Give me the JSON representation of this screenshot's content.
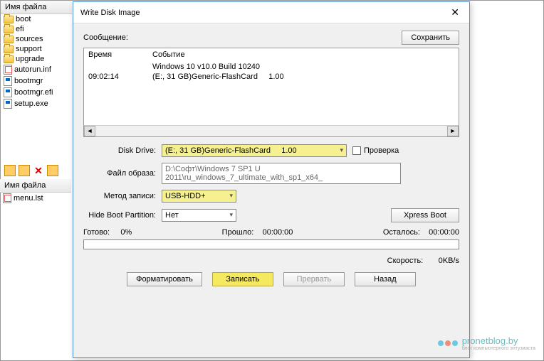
{
  "fileList": {
    "header": "Имя файла",
    "folders": [
      "boot",
      "efi",
      "sources",
      "support",
      "upgrade"
    ],
    "files": [
      {
        "name": "autorun.inf",
        "type": "ini"
      },
      {
        "name": "bootmgr",
        "type": "exe"
      },
      {
        "name": "bootmgr.efi",
        "type": "exe"
      },
      {
        "name": "setup.exe",
        "type": "exe"
      }
    ]
  },
  "fileListBottom": {
    "header": "Имя файла",
    "files": [
      {
        "name": "menu.lst",
        "type": "ini"
      }
    ]
  },
  "dialog": {
    "title": "Write Disk Image",
    "messageLabel": "Сообщение:",
    "saveBtn": "Сохранить",
    "log": {
      "timeHeader": "Время",
      "eventHeader": "Событие",
      "rows": [
        {
          "time": "",
          "event": "Windows 10 v10.0 Build 10240"
        },
        {
          "time": "09:02:14",
          "event": "(E:, 31 GB)Generic-FlashCard     1.00"
        }
      ]
    },
    "diskDrive": {
      "label": "Disk Drive:",
      "value": "(E:, 31 GB)Generic-FlashCard     1.00"
    },
    "checkLabel": "Проверка",
    "imageFile": {
      "label": "Файл образа:",
      "value": "D:\\Софт\\Windows 7 SP1 U 2011\\ru_windows_7_ultimate_with_sp1_x64_"
    },
    "writeMethod": {
      "label": "Метод записи:",
      "value": "USB-HDD+"
    },
    "hideBoot": {
      "label": "Hide Boot Partition:",
      "value": "Нет"
    },
    "xpressBoot": "Xpress Boot",
    "progress": {
      "readyLabel": "Готово:",
      "readyVal": "0%",
      "elapsedLabel": "Прошло:",
      "elapsedVal": "00:00:00",
      "remainLabel": "Осталось:",
      "remainVal": "00:00:00",
      "speedLabel": "Скорость:",
      "speedVal": "0KB/s"
    },
    "buttons": {
      "format": "Форматировать",
      "write": "Записать",
      "abort": "Прервать",
      "back": "Назад"
    }
  },
  "watermark": {
    "text": "pronetblog.by",
    "sub": "блог компьютерного энтузиаста"
  }
}
